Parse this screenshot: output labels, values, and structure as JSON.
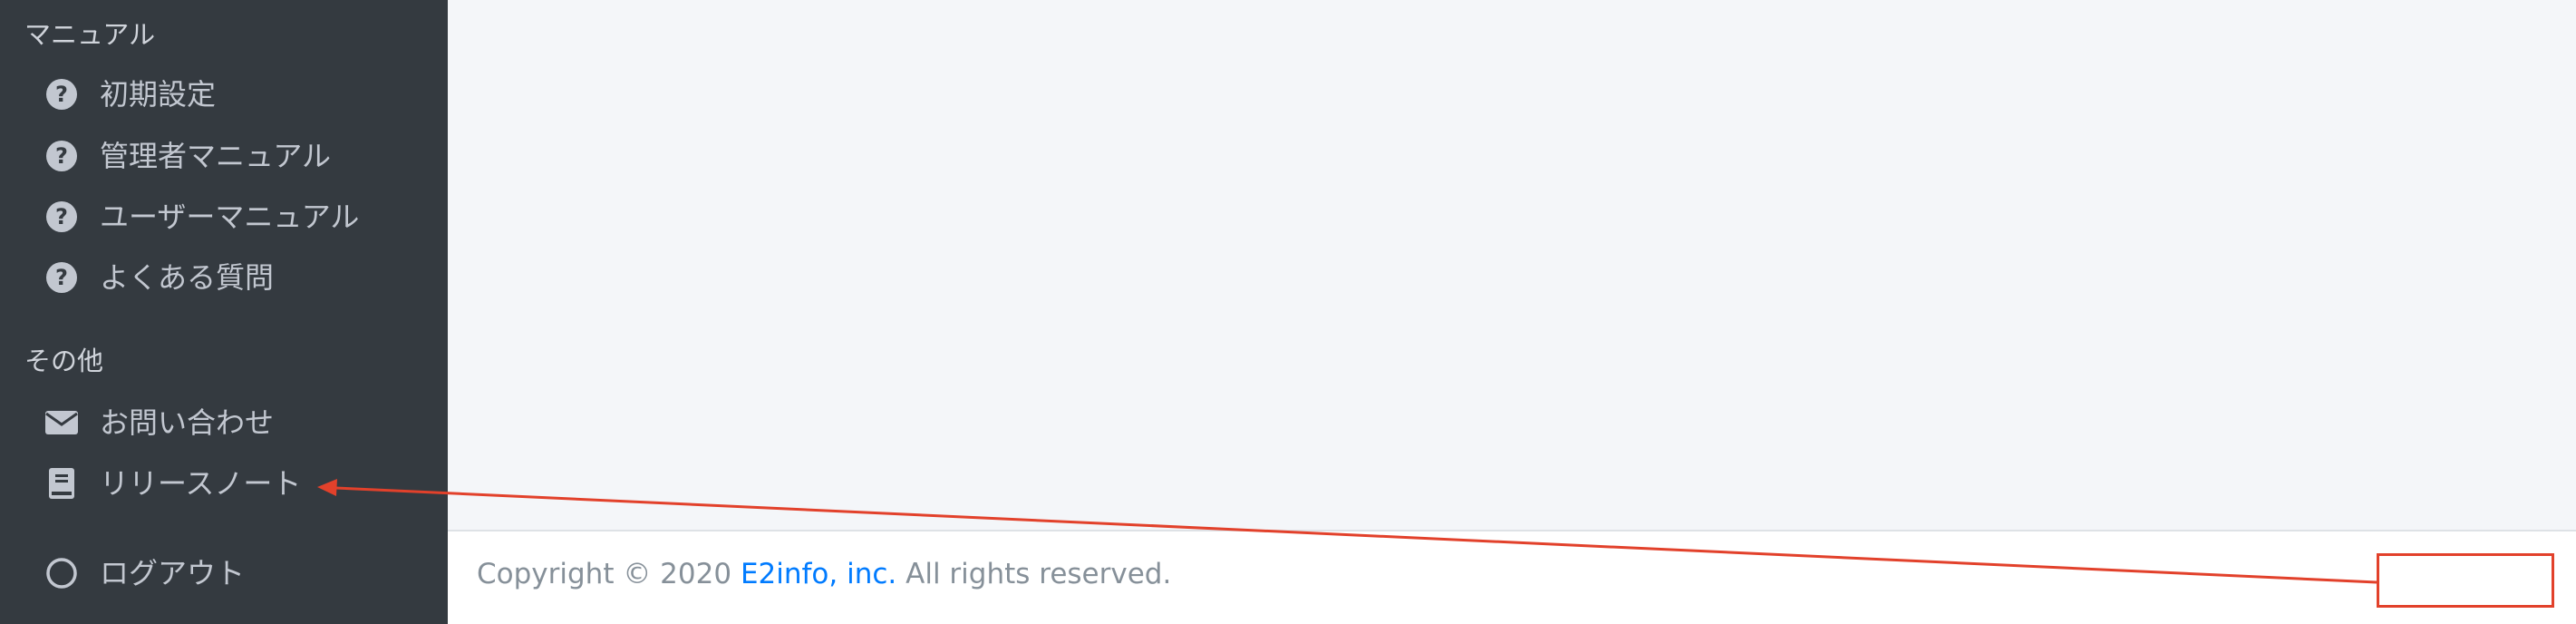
{
  "sidebar": {
    "sections": [
      {
        "header": "マニュアル",
        "items": [
          {
            "label": "初期設定",
            "icon": "question-circle-icon"
          },
          {
            "label": "管理者マニュアル",
            "icon": "question-circle-icon"
          },
          {
            "label": "ユーザーマニュアル",
            "icon": "question-circle-icon"
          },
          {
            "label": "よくある質問",
            "icon": "question-circle-icon"
          }
        ]
      },
      {
        "header": "その他",
        "items": [
          {
            "label": "お問い合わせ",
            "icon": "envelope-icon"
          },
          {
            "label": "リリースノート",
            "icon": "book-icon"
          }
        ]
      }
    ],
    "logout": {
      "label": "ログアウト",
      "icon": "circle-icon"
    }
  },
  "footer": {
    "prefix": "Copyright © 2020 ",
    "company_link": "E2info, inc.",
    "suffix": " All rights reserved."
  },
  "annotation": {
    "color": "#e2412b"
  },
  "colors": {
    "sidebar_bg": "#343a40",
    "content_bg": "#f4f6f9",
    "footer_bg": "#ffffff",
    "link": "#007bff",
    "footer_text": "#869099"
  }
}
